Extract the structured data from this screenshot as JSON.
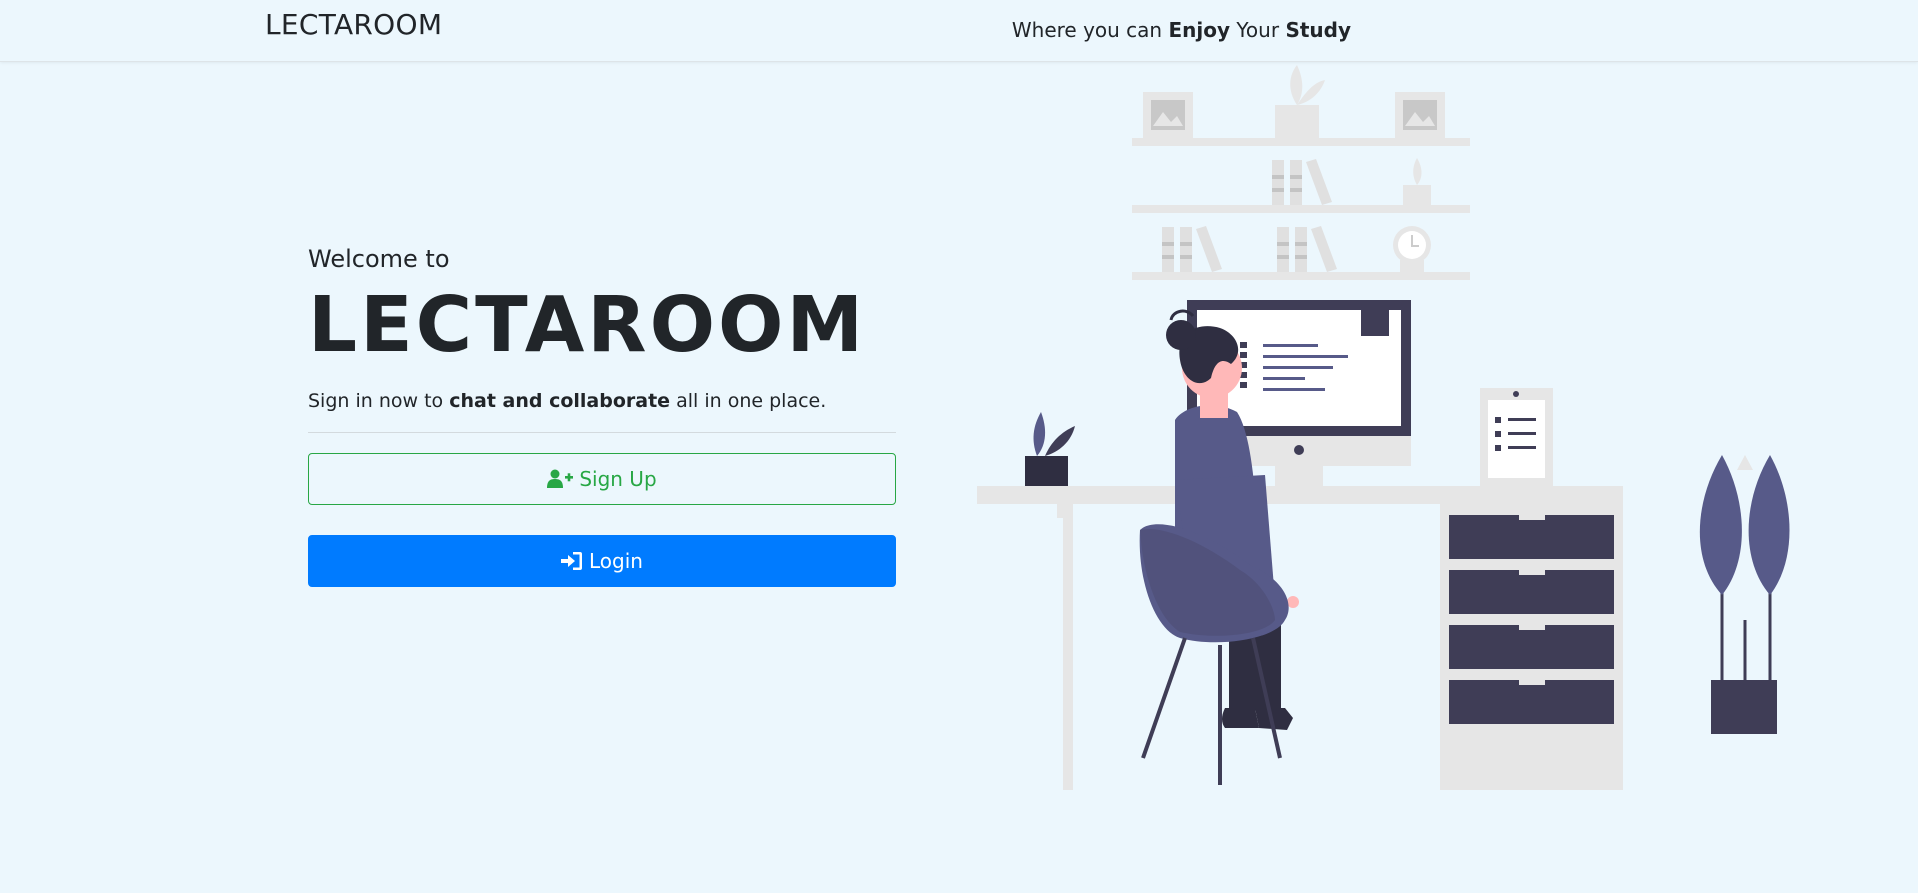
{
  "header": {
    "brand": "LECTAROOM",
    "tagline": {
      "part1": "Where you can ",
      "bold1": "Enjoy",
      "part2": " Your ",
      "bold2": "Study"
    }
  },
  "hero": {
    "welcome": "Welcome to",
    "title": "LECTAROOM",
    "lead": {
      "part1": "Sign in now to ",
      "bold": "chat and collaborate",
      "part2": " all in one place."
    }
  },
  "actions": {
    "signup_label": "Sign Up",
    "signup_icon": "user-plus-icon",
    "login_label": "Login",
    "login_icon": "sign-in-icon"
  },
  "colors": {
    "background": "#ecf7fd",
    "success": "#28a745",
    "primary": "#007bff",
    "text": "#212529",
    "illustration_dark": "#3f3d56",
    "illustration_accent": "#575a89"
  }
}
